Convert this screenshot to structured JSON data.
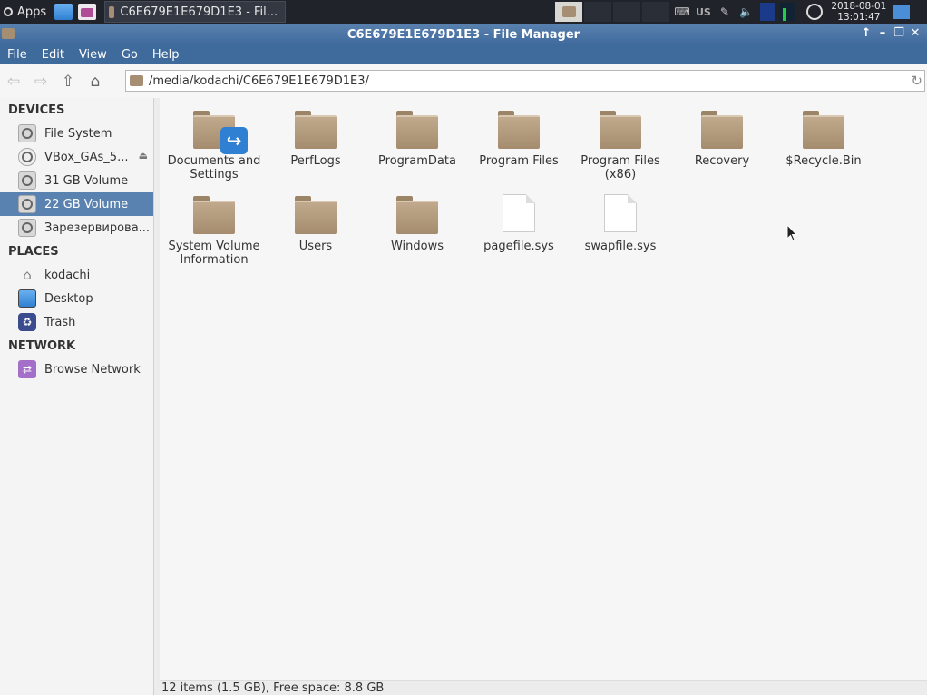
{
  "panel": {
    "apps_label": "Apps",
    "task_title": "C6E679E1E679D1E3 - Fil...",
    "keyboard_layout": "US",
    "clock_date": "2018-08-01",
    "clock_time": "13:01:47"
  },
  "window": {
    "title": "C6E679E1E679D1E3 - File Manager"
  },
  "menu": {
    "file": "File",
    "edit": "Edit",
    "view": "View",
    "go": "Go",
    "help": "Help"
  },
  "location": {
    "path": "/media/kodachi/C6E679E1E679D1E3/"
  },
  "sidebar": {
    "devices_header": "DEVICES",
    "devices": [
      {
        "label": "File System",
        "icon": "hard-disk-icon"
      },
      {
        "label": "VBox_GAs_5...",
        "icon": "cd-icon"
      },
      {
        "label": "31 GB Volume",
        "icon": "hard-disk-icon"
      },
      {
        "label": "22 GB Volume",
        "icon": "hard-disk-icon",
        "selected": true
      },
      {
        "label": "Зарезервирова...",
        "icon": "hard-disk-icon"
      }
    ],
    "places_header": "PLACES",
    "places": [
      {
        "label": "kodachi",
        "icon": "home-icon"
      },
      {
        "label": "Desktop",
        "icon": "desktop-icon"
      },
      {
        "label": "Trash",
        "icon": "trash-icon"
      }
    ],
    "network_header": "NETWORK",
    "network": [
      {
        "label": "Browse Network",
        "icon": "network-icon"
      }
    ]
  },
  "files": [
    {
      "name": "Documents and Settings",
      "type": "folder-link"
    },
    {
      "name": "PerfLogs",
      "type": "folder"
    },
    {
      "name": "ProgramData",
      "type": "folder"
    },
    {
      "name": "Program Files",
      "type": "folder"
    },
    {
      "name": "Program Files (x86)",
      "type": "folder"
    },
    {
      "name": "Recovery",
      "type": "folder"
    },
    {
      "name": "$Recycle.Bin",
      "type": "folder"
    },
    {
      "name": "System Volume Information",
      "type": "folder"
    },
    {
      "name": "Users",
      "type": "folder"
    },
    {
      "name": "Windows",
      "type": "folder"
    },
    {
      "name": "pagefile.sys",
      "type": "file"
    },
    {
      "name": "swapfile.sys",
      "type": "file"
    }
  ],
  "status": {
    "text": "12 items (1.5 GB), Free space: 8.8 GB"
  }
}
